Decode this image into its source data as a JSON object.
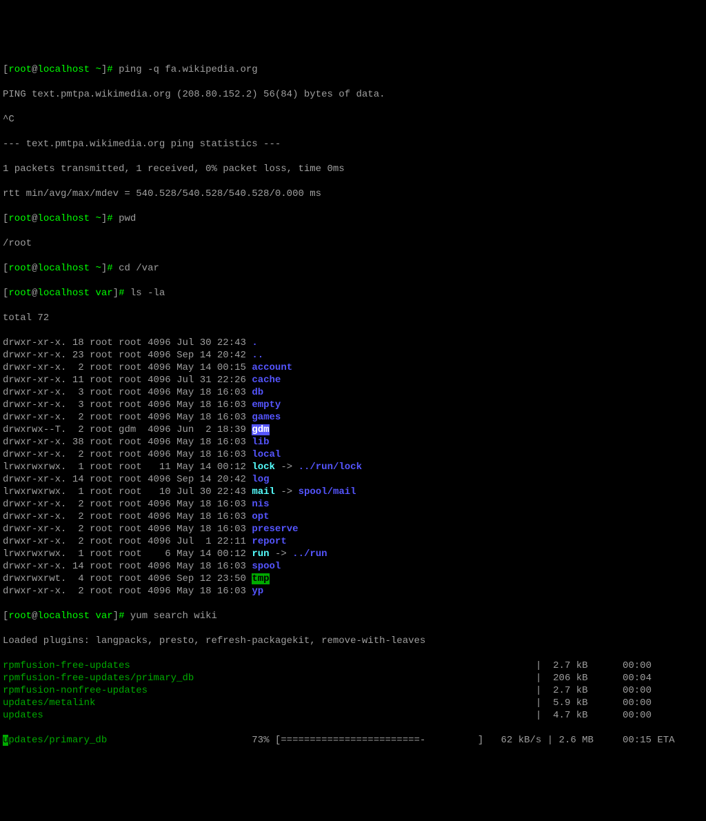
{
  "prompt": {
    "user": "root",
    "host": "localhost",
    "hash": "#",
    "home": "~",
    "vardir": "var",
    "cmd_ping": "ping -q fa.wikipedia.org",
    "cmd_pwd": "pwd",
    "cmd_cd": "cd /var",
    "cmd_ls": "ls -la",
    "cmd_yum": "yum search wiki"
  },
  "ping": {
    "l1": "PING text.pmtpa.wikimedia.org (208.80.152.2) 56(84) bytes of data.",
    "l2": "^C",
    "l3": "--- text.pmtpa.wikimedia.org ping statistics ---",
    "l4": "1 packets transmitted, 1 received, 0% packet loss, time 0ms",
    "l5": "rtt min/avg/max/mdev = 540.528/540.528/540.528/0.000 ms"
  },
  "pwd_out": "/root",
  "ls_total": "total 72",
  "ls": [
    {
      "perm": "drwxr-xr-x.",
      "n": "18",
      "own": "root root",
      "sz": "4096",
      "date": "Jul 30 22:43",
      "name": ".",
      "cls": "d-blue"
    },
    {
      "perm": "drwxr-xr-x.",
      "n": "23",
      "own": "root root",
      "sz": "4096",
      "date": "Sep 14 20:42",
      "name": "..",
      "cls": "d-blue"
    },
    {
      "perm": "drwxr-xr-x.",
      "n": " 2",
      "own": "root root",
      "sz": "4096",
      "date": "May 14 00:15",
      "name": "account",
      "cls": "d-blue"
    },
    {
      "perm": "drwxr-xr-x.",
      "n": "11",
      "own": "root root",
      "sz": "4096",
      "date": "Jul 31 22:26",
      "name": "cache",
      "cls": "d-blue"
    },
    {
      "perm": "drwxr-xr-x.",
      "n": " 3",
      "own": "root root",
      "sz": "4096",
      "date": "May 18 16:03",
      "name": "db",
      "cls": "d-blue"
    },
    {
      "perm": "drwxr-xr-x.",
      "n": " 3",
      "own": "root root",
      "sz": "4096",
      "date": "May 18 16:03",
      "name": "empty",
      "cls": "d-blue"
    },
    {
      "perm": "drwxr-xr-x.",
      "n": " 2",
      "own": "root root",
      "sz": "4096",
      "date": "May 18 16:03",
      "name": "games",
      "cls": "d-blue"
    },
    {
      "perm": "drwxrwx--T.",
      "n": " 2",
      "own": "root gdm ",
      "sz": "4096",
      "date": "Jun  2 18:39",
      "name": "gdm",
      "cls": "hl-blue"
    },
    {
      "perm": "drwxr-xr-x.",
      "n": "38",
      "own": "root root",
      "sz": "4096",
      "date": "May 18 16:03",
      "name": "lib",
      "cls": "d-blue"
    },
    {
      "perm": "drwxr-xr-x.",
      "n": " 2",
      "own": "root root",
      "sz": "4096",
      "date": "May 18 16:03",
      "name": "local",
      "cls": "d-blue"
    },
    {
      "perm": "lrwxrwxrwx.",
      "n": " 1",
      "own": "root root",
      "sz": "  11",
      "date": "May 14 00:12",
      "name": "lock",
      "cls": "d-cyan",
      "link": "../run/lock",
      "lcls": "d-blue"
    },
    {
      "perm": "drwxr-xr-x.",
      "n": "14",
      "own": "root root",
      "sz": "4096",
      "date": "Sep 14 20:42",
      "name": "log",
      "cls": "d-blue"
    },
    {
      "perm": "lrwxrwxrwx.",
      "n": " 1",
      "own": "root root",
      "sz": "  10",
      "date": "Jul 30 22:43",
      "name": "mail",
      "cls": "d-cyan",
      "link": "spool/mail",
      "lcls": "d-blue"
    },
    {
      "perm": "drwxr-xr-x.",
      "n": " 2",
      "own": "root root",
      "sz": "4096",
      "date": "May 18 16:03",
      "name": "nis",
      "cls": "d-blue"
    },
    {
      "perm": "drwxr-xr-x.",
      "n": " 2",
      "own": "root root",
      "sz": "4096",
      "date": "May 18 16:03",
      "name": "opt",
      "cls": "d-blue"
    },
    {
      "perm": "drwxr-xr-x.",
      "n": " 2",
      "own": "root root",
      "sz": "4096",
      "date": "May 18 16:03",
      "name": "preserve",
      "cls": "d-blue"
    },
    {
      "perm": "drwxr-xr-x.",
      "n": " 2",
      "own": "root root",
      "sz": "4096",
      "date": "Jul  1 22:11",
      "name": "report",
      "cls": "d-blue"
    },
    {
      "perm": "lrwxrwxrwx.",
      "n": " 1",
      "own": "root root",
      "sz": "   6",
      "date": "May 14 00:12",
      "name": "run",
      "cls": "d-cyan",
      "link": "../run",
      "lcls": "d-blue"
    },
    {
      "perm": "drwxr-xr-x.",
      "n": "14",
      "own": "root root",
      "sz": "4096",
      "date": "May 18 16:03",
      "name": "spool",
      "cls": "d-blue"
    },
    {
      "perm": "drwxrwxrwt.",
      "n": " 4",
      "own": "root root",
      "sz": "4096",
      "date": "Sep 12 23:50",
      "name": "tmp",
      "cls": "hl-green"
    },
    {
      "perm": "drwxr-xr-x.",
      "n": " 2",
      "own": "root root",
      "sz": "4096",
      "date": "May 18 16:03",
      "name": "yp",
      "cls": "d-blue"
    }
  ],
  "yum": {
    "plugins": "Loaded plugins: langpacks, presto, refresh-packagekit, remove-with-leaves",
    "rows": [
      {
        "repo": "rpmfusion-free-updates",
        "size": "2.7 kB",
        "time": "00:00"
      },
      {
        "repo": "rpmfusion-free-updates/primary_db",
        "size": "206 kB",
        "time": "00:04"
      },
      {
        "repo": "rpmfusion-nonfree-updates",
        "size": "2.7 kB",
        "time": "00:00"
      },
      {
        "repo": "updates/metalink",
        "size": "5.9 kB",
        "time": "00:00"
      },
      {
        "repo": "updates",
        "size": "4.7 kB",
        "time": "00:00"
      }
    ],
    "progress": {
      "label_first": "u",
      "label_rest": "pdates/primary_db",
      "percent": "73%",
      "bar": "[========================-         ]",
      "rate": "62 kB/s",
      "size": "2.6 MB",
      "eta": "00:15 ETA"
    }
  }
}
